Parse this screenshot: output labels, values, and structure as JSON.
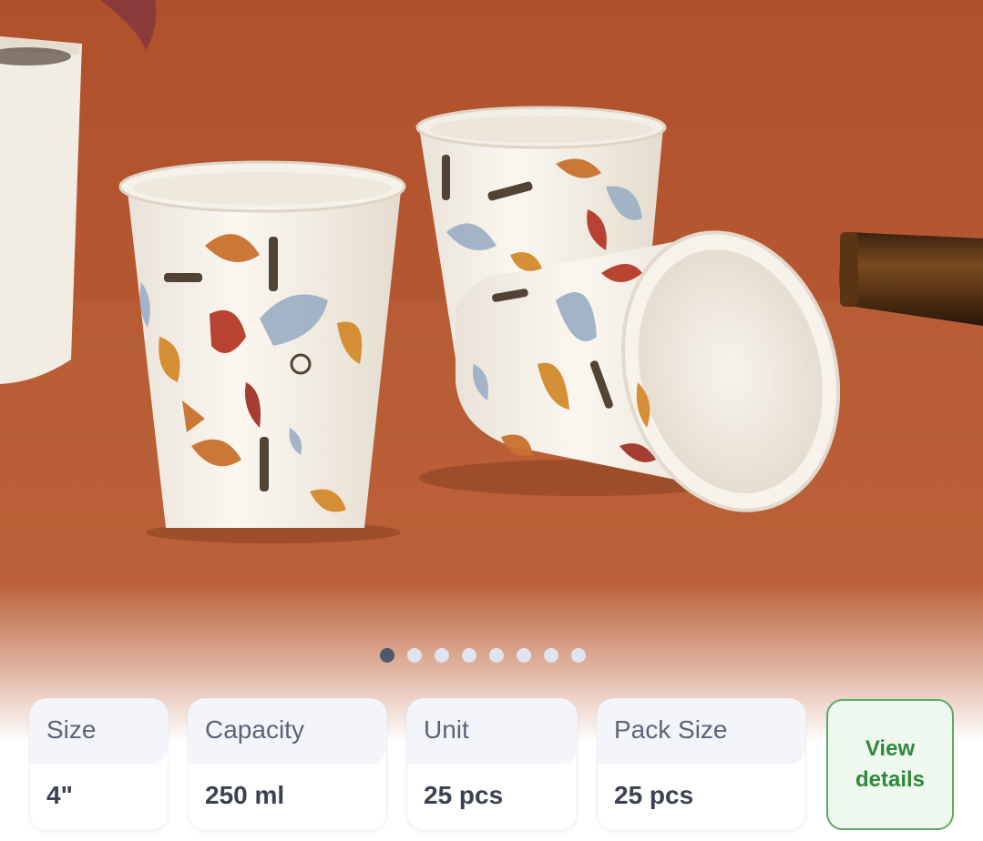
{
  "gallery": {
    "image_description_icon": "paper-cups-photo",
    "total_slides": 8,
    "active_index": 0
  },
  "specs": [
    {
      "label": "Size",
      "value": "4\""
    },
    {
      "label": "Capacity",
      "value": "250 ml"
    },
    {
      "label": "Unit",
      "value": "25 pcs"
    },
    {
      "label": "Pack Size",
      "value": "25 pcs"
    }
  ],
  "actions": {
    "view_details_label": "View details"
  },
  "colors": {
    "background_orange": "#b45a33",
    "accent_green": "#2e8a3a",
    "dot_active": "#4d5a6e",
    "dot_inactive": "#dfe4ee"
  }
}
